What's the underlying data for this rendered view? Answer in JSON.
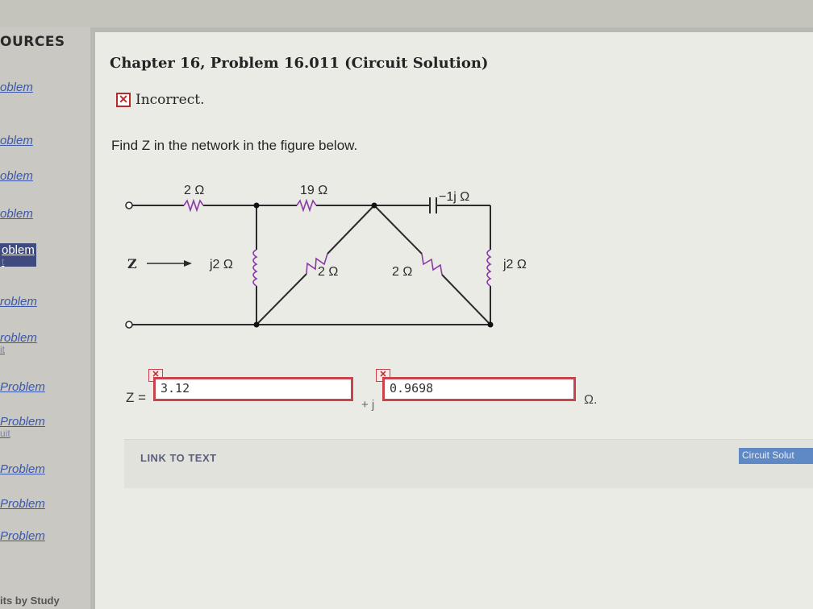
{
  "sidebar": {
    "title": "OURCES",
    "items": [
      {
        "label": "oblem",
        "sub": ""
      },
      {
        "label": "oblem",
        "sub": ""
      },
      {
        "label": "oblem",
        "sub": ""
      },
      {
        "label": "oblem",
        "sub": ""
      },
      {
        "label": "oblem",
        "sub": "t"
      },
      {
        "label": "roblem",
        "sub": ""
      },
      {
        "label": "roblem",
        "sub": "it"
      },
      {
        "label": "Problem",
        "sub": ""
      },
      {
        "label": "Problem",
        "sub": "uit"
      },
      {
        "label": "Problem",
        "sub": ""
      },
      {
        "label": "Problem",
        "sub": ""
      },
      {
        "label": "Problem",
        "sub": ""
      }
    ],
    "footer": "its by Study"
  },
  "main": {
    "title": "Chapter 16, Problem 16.011 (Circuit Solution)",
    "status_icon": "x-icon",
    "status_text": "Incorrect.",
    "question": "Find Z in the network in the figure below.",
    "circuit": {
      "r1": "2 Ω",
      "r2": "19 Ω",
      "cap": "−1j Ω",
      "ind1": "j2 Ω",
      "r3": "2 Ω",
      "r4": "2 Ω",
      "ind2": "j2 Ω",
      "z": "Z"
    },
    "answer": {
      "label": "Z =",
      "real_value": "3.12",
      "plus_j": "+ j",
      "imag_value": "0.9698",
      "unit": "Ω."
    },
    "link_text": "LINK TO TEXT",
    "ref_button": "Circuit Solut"
  },
  "colors": {
    "error": "#c9434c",
    "link": "#3c58a8",
    "button": "#5f89c4"
  }
}
